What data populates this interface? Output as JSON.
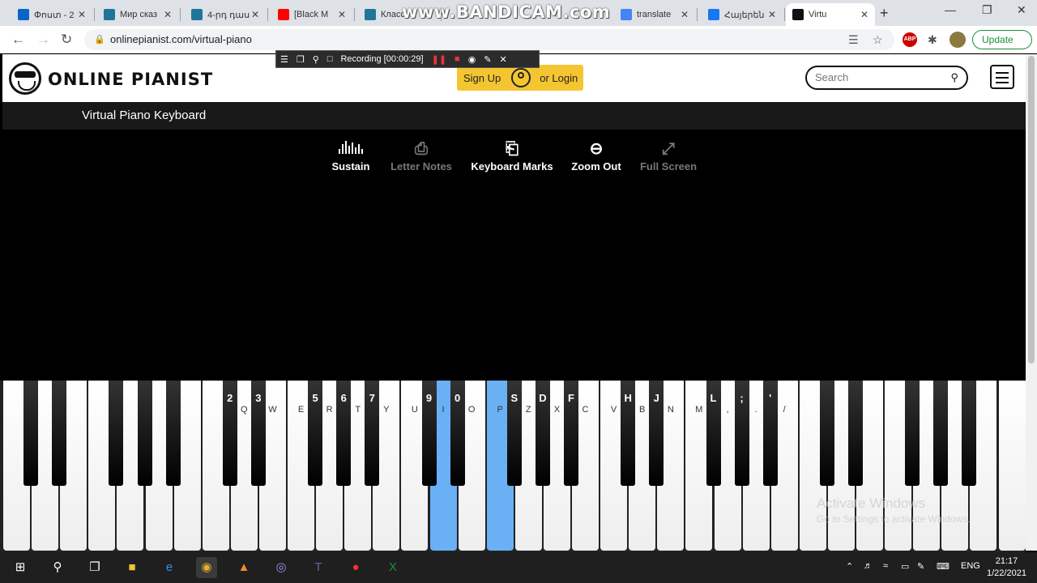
{
  "browser": {
    "tabs": [
      {
        "title": "Փոստ - 2",
        "icon": "outlook-icon",
        "color": "#0a64c8"
      },
      {
        "title": "Мир сказ",
        "icon": "wordpress-icon",
        "color": "#21759b"
      },
      {
        "title": "4-րդ դաս",
        "icon": "wordpress-icon",
        "color": "#21759b"
      },
      {
        "title": "[Black M",
        "icon": "youtube-icon",
        "color": "#ff0000"
      },
      {
        "title": "Классны",
        "icon": "wordpress-icon",
        "color": "#21759b"
      },
      {
        "title": "translate",
        "icon": "google-icon",
        "color": "#4285f4"
      },
      {
        "title": "Հայերեն",
        "icon": "facebook-icon",
        "color": "#1877f2"
      },
      {
        "title": "Virtu",
        "icon": "pianist-icon",
        "color": "#111111",
        "active": true
      }
    ],
    "watermark": "www.BANDICAM.com",
    "url": "onlinepianist.com/virtual-piano",
    "update_label": "Update",
    "abp_badge": "ABP"
  },
  "recorder": {
    "status": "Recording [00:00:29]"
  },
  "site": {
    "logo": "ONLINE PIANIST",
    "signup": "Sign Up",
    "login": "or Login",
    "search_placeholder": "Search",
    "subtitle": "Virtual Piano Keyboard"
  },
  "controls": [
    {
      "label": "Sustain",
      "icon": "sustain-icon",
      "active": true
    },
    {
      "label": "Letter Notes",
      "icon": "letter-notes-icon",
      "active": false
    },
    {
      "label": "Keyboard Marks",
      "icon": "keyboard-marks-icon",
      "active": true
    },
    {
      "label": "Zoom Out",
      "icon": "zoom-out-icon",
      "active": true
    },
    {
      "label": "Full Screen",
      "icon": "full-screen-icon",
      "active": false
    }
  ],
  "piano": {
    "highlight_color": "#6ab0f5",
    "white_labels": [
      "",
      "",
      "",
      "",
      "",
      "",
      "",
      "",
      "Q",
      "W",
      "E",
      "R",
      "T",
      "Y",
      "U",
      "I",
      "O",
      "P",
      "Z",
      "X",
      "C",
      "V",
      "B",
      "N",
      "M",
      ",",
      ".",
      "/",
      "",
      "",
      "",
      "",
      "",
      "",
      "",
      ""
    ],
    "white_highlight": [
      15,
      17
    ],
    "black_labels": [
      "",
      "",
      "",
      "",
      "",
      "2",
      "3",
      "5",
      "6",
      "7",
      "9",
      "0",
      "S",
      "D",
      "F",
      "H",
      "J",
      "L",
      ";",
      "'",
      "",
      "",
      "",
      "",
      ""
    ]
  },
  "windows_watermark": {
    "line1": "Activate Windows",
    "line2": "Go to Settings to activate Windows."
  },
  "taskbar": {
    "language": "ENG",
    "time": "21:17",
    "date": "1/22/2021"
  }
}
